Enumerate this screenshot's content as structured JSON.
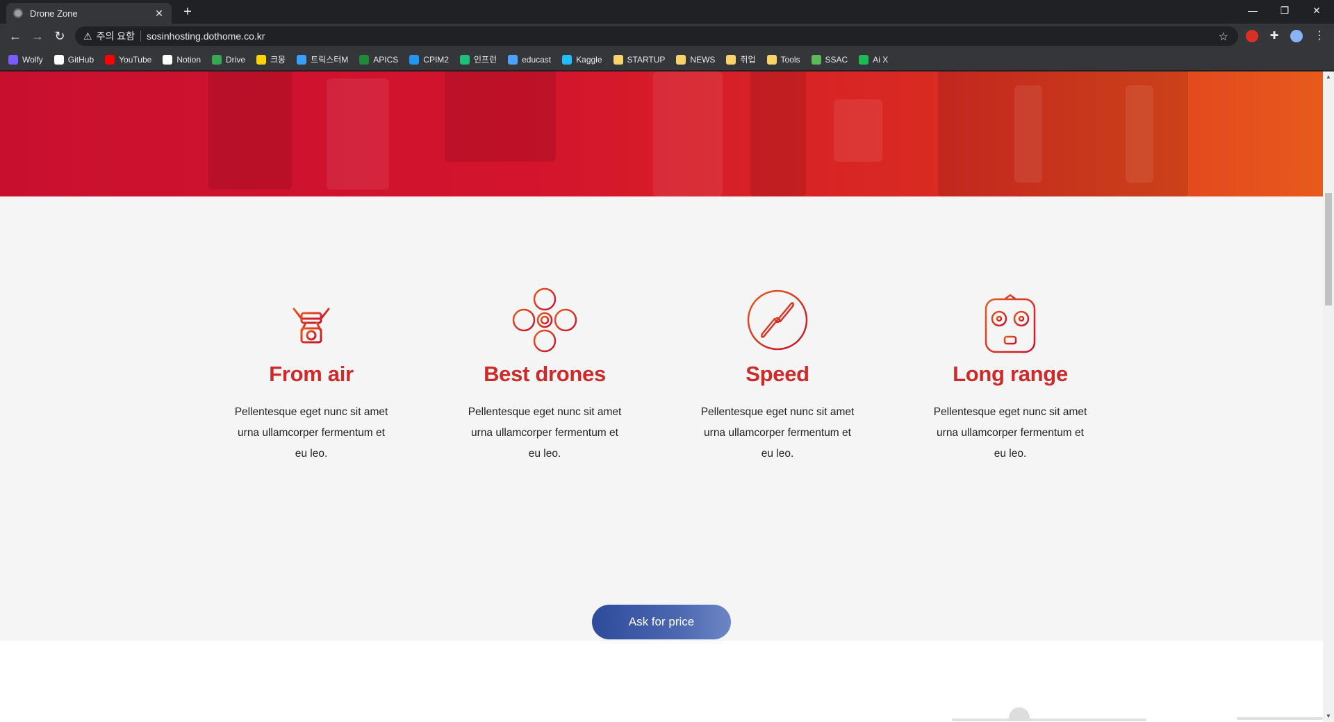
{
  "browser": {
    "tab_title": "Drone Zone",
    "address_security": "주의 요함",
    "address_url": "sosinhosting.dothome.co.kr",
    "bookmarks": [
      {
        "label": "Wolfy",
        "color": "#7b5cff"
      },
      {
        "label": "GitHub",
        "color": "#ffffff"
      },
      {
        "label": "YouTube",
        "color": "#ff0000"
      },
      {
        "label": "Notion",
        "color": "#ffffff"
      },
      {
        "label": "Drive",
        "color": "#34a853"
      },
      {
        "label": "크몽",
        "color": "#ffd400"
      },
      {
        "label": "트릭스터M",
        "color": "#3aa0ff"
      },
      {
        "label": "APICS",
        "color": "#1f8a3a"
      },
      {
        "label": "CPIM2",
        "color": "#2196f3"
      },
      {
        "label": "인프런",
        "color": "#1dc078"
      },
      {
        "label": "educast",
        "color": "#4aa3ff"
      },
      {
        "label": "Kaggle",
        "color": "#20beff"
      },
      {
        "label": "STARTUP",
        "color": "#f6d36b"
      },
      {
        "label": "NEWS",
        "color": "#f6d36b"
      },
      {
        "label": "취업",
        "color": "#f6d36b"
      },
      {
        "label": "Tools",
        "color": "#f6d36b"
      },
      {
        "label": "SSAC",
        "color": "#5bb85b"
      },
      {
        "label": "Ai X",
        "color": "#1db954"
      }
    ]
  },
  "features": [
    {
      "title": "From air",
      "text": "Pellentesque eget nunc sit amet urna ullamcorper fermentum et eu leo.",
      "icon": "drone-camera-icon"
    },
    {
      "title": "Best drones",
      "text": "Pellentesque eget nunc sit amet urna ullamcorper fermentum et eu leo.",
      "icon": "quadcopter-icon"
    },
    {
      "title": "Speed",
      "text": "Pellentesque eget nunc sit amet urna ullamcorper fermentum et eu leo.",
      "icon": "propeller-icon"
    },
    {
      "title": "Long range",
      "text": "Pellentesque eget nunc sit amet urna ullamcorper fermentum et eu leo.",
      "icon": "remote-controller-icon"
    }
  ],
  "cta_label": "Ask for price",
  "colors": {
    "accent_red": "#cf2a2a",
    "button_blue": "#3b56a4"
  }
}
